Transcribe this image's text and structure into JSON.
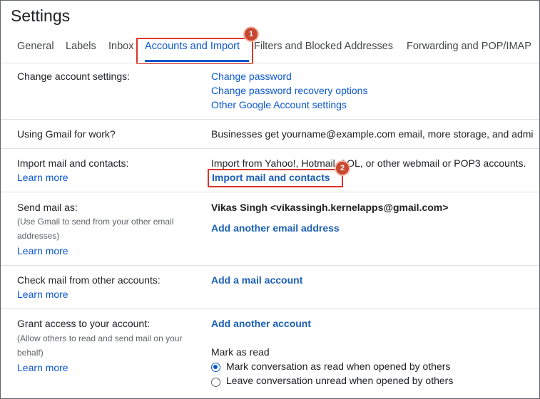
{
  "page_title": "Settings",
  "tabs": [
    {
      "label": "General"
    },
    {
      "label": "Labels"
    },
    {
      "label": "Inbox"
    },
    {
      "label": "Accounts and Import"
    },
    {
      "label": "Filters and Blocked Addresses"
    },
    {
      "label": "Forwarding and POP/IMAP"
    }
  ],
  "badges": {
    "one": "1",
    "two": "2"
  },
  "change_account": {
    "label": "Change account settings:",
    "links": [
      "Change password",
      "Change password recovery options",
      "Other Google Account settings"
    ]
  },
  "gmail_work": {
    "label": "Using Gmail for work?",
    "text": "Businesses get yourname@example.com email, more storage, and admi"
  },
  "import_mail": {
    "label": "Import mail and contacts:",
    "learn_more": "Learn more",
    "text": "Import from Yahoo!, Hotmail, AOL, or other webmail or POP3 accounts.",
    "action": "Import mail and contacts"
  },
  "send_mail": {
    "label": "Send mail as:",
    "sub": "(Use Gmail to send from your other email addresses)",
    "learn_more": "Learn more",
    "account": "Vikas Singh <vikassingh.kernelapps@gmail.com>",
    "action": "Add another email address"
  },
  "check_mail": {
    "label": "Check mail from other accounts:",
    "learn_more": "Learn more",
    "action": "Add a mail account"
  },
  "grant_access": {
    "label": "Grant access to your account:",
    "sub": "(Allow others to read and send mail on your behalf)",
    "learn_more": "Learn more",
    "action": "Add another account",
    "mark_as_read_heading": "Mark as read",
    "options": [
      {
        "label": "Mark conversation as read when opened by others",
        "selected": true
      },
      {
        "label": "Leave conversation unread when opened by others",
        "selected": false
      }
    ]
  },
  "colors": {
    "accent": "#0b57d0",
    "highlight": "#d9352b",
    "badge": "#c9472e"
  }
}
